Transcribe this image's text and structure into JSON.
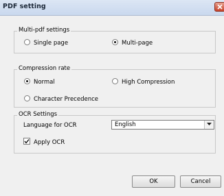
{
  "window": {
    "title": "PDF setting"
  },
  "icons": {
    "close": "close-icon",
    "dropdown": "chevron-down-icon",
    "check": "checkmark-icon"
  },
  "multi_pdf": {
    "legend": "Multi-pdf settings",
    "options": [
      {
        "label": "Single page",
        "selected": false
      },
      {
        "label": "Multi-page",
        "selected": true
      }
    ]
  },
  "compression": {
    "legend": "Compression rate",
    "options": [
      {
        "label": "Normal",
        "selected": true
      },
      {
        "label": "High Compression",
        "selected": false
      },
      {
        "label": "Character Precedence",
        "selected": false
      }
    ]
  },
  "ocr": {
    "legend": "OCR Settings",
    "language_label": "Language for OCR",
    "language_value": "English",
    "apply_label": "Apply OCR",
    "apply_checked": true
  },
  "buttons": {
    "ok": "OK",
    "cancel": "Cancel"
  }
}
